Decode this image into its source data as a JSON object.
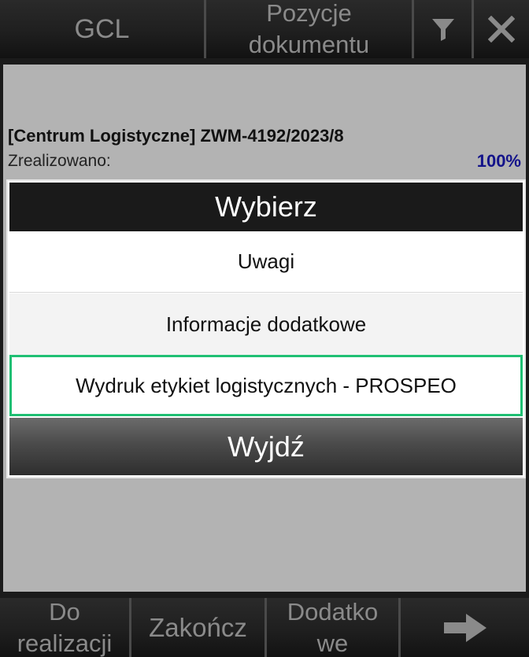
{
  "topbar": {
    "gcl_label": "GCL",
    "title_line1": "Pozycje",
    "title_line2": "dokumentu",
    "filter_icon": "filter-icon",
    "close_icon": "close-icon"
  },
  "document": {
    "title": "[Centrum Logistyczne] ZWM-4192/2023/8",
    "progress_label": "Zrealizowano:",
    "progress_value": "100%"
  },
  "modal": {
    "title": "Wybierz",
    "options": [
      {
        "label": "Uwagi"
      },
      {
        "label": "Informacje dodatkowe"
      },
      {
        "label": "Wydruk etykiet logistycznych - PROSPEO"
      }
    ],
    "exit_label": "Wyjdź"
  },
  "bottombar": {
    "to_do_line1": "Do",
    "to_do_line2": "realizacji",
    "finish_label": "Zakończ",
    "extra_line1": "Dodatko",
    "extra_line2": "we",
    "next_icon": "arrow-right-icon"
  },
  "colors": {
    "accent_border": "#1fbf73",
    "progress_value": "#13138a"
  }
}
